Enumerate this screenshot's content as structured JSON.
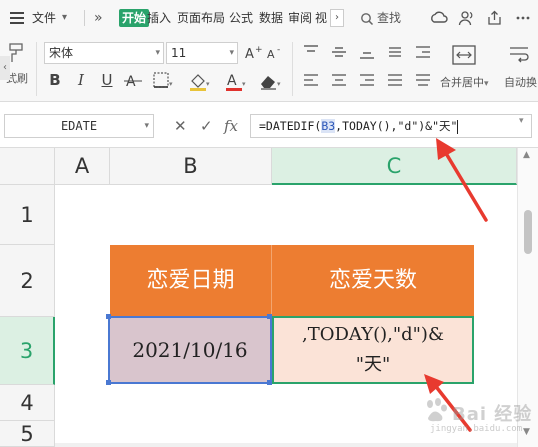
{
  "menu": {
    "file_label": "文件",
    "more_glyph": "»",
    "tabs": [
      "开始",
      "插入",
      "页面布局",
      "公式",
      "数据",
      "审阅",
      "视"
    ],
    "search_label": "查找",
    "right_icons": [
      "cloud-sync-icon",
      "people-icon",
      "share-icon",
      "more-dots-icon"
    ]
  },
  "ribbon": {
    "left_cut_label": "式刷",
    "font_name": "宋体",
    "font_size": "11",
    "format_buttons": [
      "B",
      "I",
      "U"
    ],
    "merge_label": "合并居中",
    "wrap_label": "自动换",
    "dropdown_glyph": "▾"
  },
  "formula_bar": {
    "name_box": "EDATE",
    "cancel_glyph": "✕",
    "confirm_glyph": "✓",
    "fx_label": "fx",
    "formula_prefix": "=DATEDIF(",
    "formula_ref": "B3",
    "formula_suffix": ",TODAY(),\"d\")&\"天\""
  },
  "grid": {
    "columns": [
      "A",
      "B",
      "C"
    ],
    "rows": [
      "1",
      "2",
      "3",
      "4",
      "5"
    ],
    "selected_column": "C",
    "selected_row": "3",
    "cells": {
      "B2": "恋爱日期",
      "C2": "恋爱天数",
      "B3": "2021/10/16",
      "C3_line1": ",TODAY(),\"d\")&",
      "C3_line2": "\"天\""
    }
  },
  "colors": {
    "accent_green": "#2aa36b",
    "header_orange": "#ed7d31",
    "date_cell_fill": "#d9c5cd",
    "edit_cell_fill": "#fbe3d7",
    "reference_blue": "#4a78d2",
    "arrow_red": "#e83a2f"
  },
  "watermark": {
    "icon": "baidu-paw-icon",
    "text": "Bai 经验",
    "sub": "jingyan.baidu.com"
  }
}
